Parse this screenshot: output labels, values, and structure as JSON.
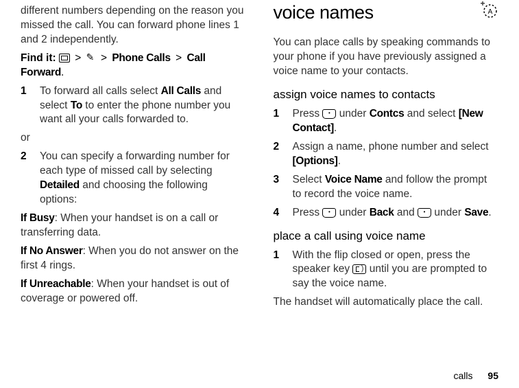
{
  "left": {
    "intro": "different numbers depending on the reason you missed the call. You can forward phone lines 1 and 2 independently.",
    "findit_label": "Find it:",
    "findit_path1": "Phone Calls",
    "findit_path2": "Call Forward",
    "step1_num": "1",
    "step1_a": "To forward all calls select ",
    "step1_allcalls": "All Calls",
    "step1_b": " and select ",
    "step1_to": "To",
    "step1_c": " to enter the phone number you want all your calls forwarded to.",
    "or": "or",
    "step2_num": "2",
    "step2_a": "You can specify a forwarding number for each type of missed call by selecting ",
    "step2_detailed": "Detailed",
    "step2_b": " and choosing the following options:",
    "ifbusy_h": "If Busy",
    "ifbusy_t": ": When your handset is on a call or transferring data.",
    "ifnoans_h": "If No Answer",
    "ifnoans_t": ": When you do not answer on the first 4 rings.",
    "ifunr_h": "If Unreachable",
    "ifunr_t": ": When your handset is out of coverage or powered off."
  },
  "right": {
    "title": "voice names",
    "intro": "You can place calls by speaking commands to your phone if you have previously assigned a voice name to your contacts.",
    "assign_h": "assign voice names to contacts",
    "a1_num": "1",
    "a1_a": "Press ",
    "a1_b": " under ",
    "a1_contcs": "Contcs",
    "a1_c": " and select ",
    "a1_new": "[New Contact]",
    "a1_d": ".",
    "a2_num": "2",
    "a2_a": "Assign a name, phone number and select ",
    "a2_opt": "[Options]",
    "a2_b": ".",
    "a3_num": "3",
    "a3_a": "Select ",
    "a3_vn": "Voice Name",
    "a3_b": " and follow the prompt to record the voice name.",
    "a4_num": "4",
    "a4_a": "Press ",
    "a4_b": " under ",
    "a4_back": "Back",
    "a4_c": " and ",
    "a4_d": " under ",
    "a4_save": "Save",
    "a4_e": ".",
    "place_h": "place a call using voice name",
    "p1_num": "1",
    "p1_a": "With the flip closed or open, press the speaker key ",
    "p1_b": " until you are prompted to say the voice name.",
    "outro": "The handset will automatically place the call."
  },
  "footer": {
    "section": "calls",
    "page": "95"
  }
}
